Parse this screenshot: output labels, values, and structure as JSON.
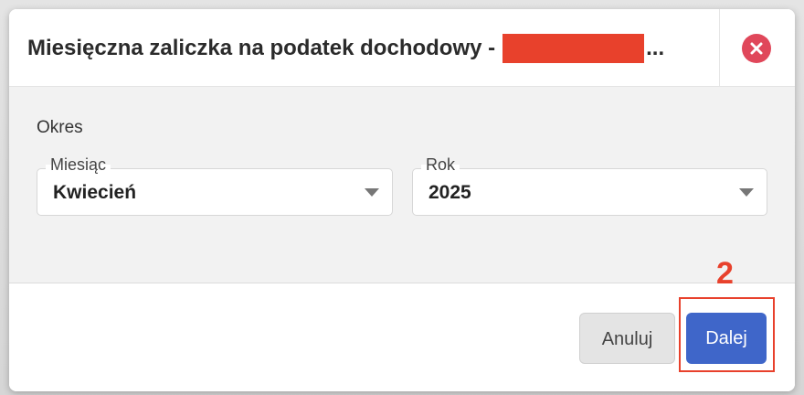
{
  "dialog": {
    "title": "Miesięczna zaliczka na podatek dochodowy -",
    "title_ellipsis": "...",
    "close_icon": "close-circle-icon",
    "redaction_color": "#e8412c"
  },
  "form": {
    "section_label": "Okres",
    "month": {
      "label": "Miesiąc",
      "value": "Kwiecień"
    },
    "year": {
      "label": "Rok",
      "value": "2025"
    }
  },
  "footer": {
    "cancel_label": "Anuluj",
    "next_label": "Dalej"
  },
  "annotation": {
    "number": "2",
    "color": "#e8412c"
  },
  "colors": {
    "primary": "#3f66c9",
    "close": "#e0475a"
  }
}
